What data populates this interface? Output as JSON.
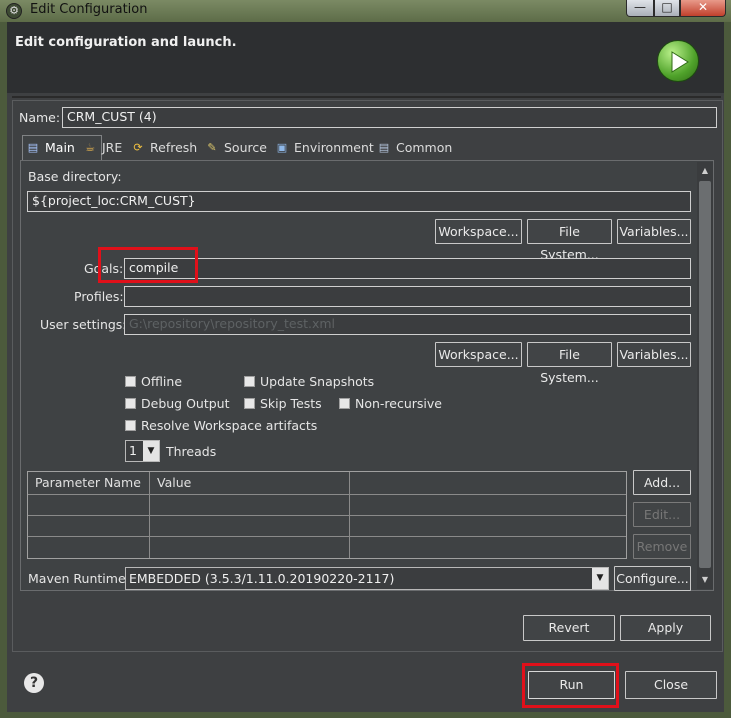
{
  "window": {
    "title": "Edit Configuration",
    "title_icon": "gear-icon",
    "header": "Edit configuration and launch.",
    "controls": {
      "minimize": "—",
      "maximize": "□",
      "close": "✕"
    }
  },
  "name_label": "Name:",
  "name_value": "CRM_CUST (4)",
  "tabs": [
    {
      "label": "Main",
      "icon": "main-tab-icon",
      "glyph": "▤"
    },
    {
      "label": "JRE",
      "icon": "jre-tab-icon",
      "glyph": "☕"
    },
    {
      "label": "Refresh",
      "icon": "refresh-tab-icon",
      "glyph": "⟳"
    },
    {
      "label": "Source",
      "icon": "source-tab-icon",
      "glyph": "✎"
    },
    {
      "label": "Environment",
      "icon": "environment-tab-icon",
      "glyph": "▣"
    },
    {
      "label": "Common",
      "icon": "common-tab-icon",
      "glyph": "▤"
    }
  ],
  "main": {
    "base_directory_label": "Base directory:",
    "base_directory_value": "${project_loc:CRM_CUST}",
    "buttons_row1": [
      "Workspace...",
      "File System...",
      "Variables..."
    ],
    "goals_label": "Goals:",
    "goals_value": "compile",
    "profiles_label": "Profiles:",
    "profiles_value": "",
    "user_settings_label": "User settings:",
    "user_settings_value": "G:\\repository\\repository_test.xml",
    "buttons_row2": [
      "Workspace...",
      "File System...",
      "Variables..."
    ],
    "checkboxes": {
      "offline": "Offline",
      "update_snapshots": "Update Snapshots",
      "debug_output": "Debug Output",
      "skip_tests": "Skip Tests",
      "non_recursive": "Non-recursive",
      "resolve_workspace": "Resolve Workspace artifacts"
    },
    "threads_value": "1",
    "threads_label": "Threads",
    "table_headers": [
      "Parameter Name",
      "Value"
    ],
    "table_buttons": {
      "add": "Add...",
      "edit": "Edit...",
      "remove": "Remove"
    },
    "maven_runtime_label": "Maven Runtime:",
    "maven_runtime_value": "EMBEDDED (3.5.3/1.11.0.20190220-2117)",
    "configure_button": "Configure..."
  },
  "actions": {
    "revert": "Revert",
    "apply": "Apply",
    "run": "Run",
    "close": "Close"
  },
  "help": "?"
}
